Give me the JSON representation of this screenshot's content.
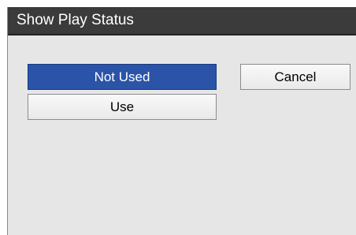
{
  "dialog": {
    "title": "Show Play Status",
    "options": [
      {
        "label": "Not Used",
        "selected": true
      },
      {
        "label": "Use",
        "selected": false
      }
    ],
    "cancel_label": "Cancel"
  },
  "colors": {
    "title_bar": "#3b3b3b",
    "selected_option": "#2b54a8",
    "dialog_background": "#e6e6e6"
  }
}
